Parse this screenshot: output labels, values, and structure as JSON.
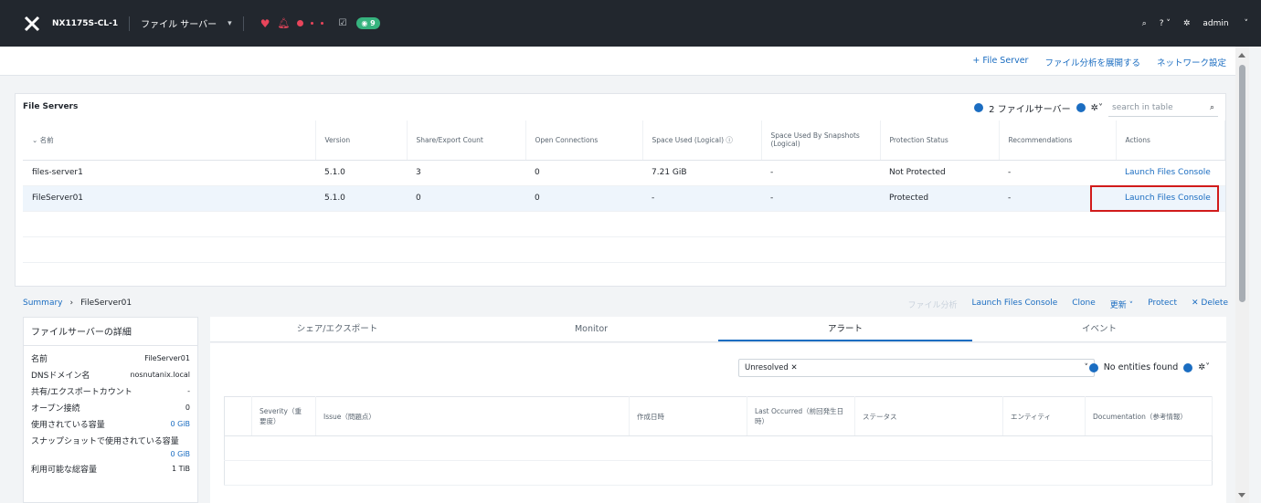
{
  "topnav": {
    "cluster": "NX1175S-CL-1",
    "menu": "ファイル サーバー",
    "task_count": "9",
    "user": "admin"
  },
  "actionbar": {
    "add_file_server": "+ File Server",
    "deploy_analytics": "ファイル分析を展開する",
    "network_settings": "ネットワーク設定"
  },
  "file_servers": {
    "title": "File Servers",
    "count_label": "2 ファイルサーバー",
    "search_placeholder": "search in table",
    "columns": [
      "名前",
      "Version",
      "Share/Export Count",
      "Open Connections",
      "Space Used (Logical)",
      "Space Used By Snapshots (Logical)",
      "Protection Status",
      "Recommendations",
      "Actions"
    ],
    "rows": [
      {
        "name": "files-server1",
        "version": "5.1.0",
        "shares": "3",
        "connections": "0",
        "space": "7.21 GiB",
        "snap": "-",
        "protection": "Not Protected",
        "rec": "-",
        "action": "Launch Files Console"
      },
      {
        "name": "FileServer01",
        "version": "5.1.0",
        "shares": "0",
        "connections": "0",
        "space": "-",
        "snap": "-",
        "protection": "Protected",
        "rec": "-",
        "action": "Launch Files Console"
      }
    ]
  },
  "summary": {
    "crumb_root": "Summary",
    "crumb_current": "FileServer01",
    "actions": {
      "analytics": "ファイル分析",
      "launch": "Launch Files Console",
      "clone": "Clone",
      "update": "更新",
      "protect": "Protect",
      "delete": "Delete"
    }
  },
  "details": {
    "title": "ファイルサーバーの詳細",
    "rows": [
      {
        "label": "名前",
        "value": "FileServer01"
      },
      {
        "label": "DNSドメイン名",
        "value": "nosnutanix.local"
      },
      {
        "label": "共有/エクスポートカウント",
        "value": "-"
      },
      {
        "label": "オープン接続",
        "value": "0"
      },
      {
        "label": "使用されている容量",
        "value": "0 GiB"
      }
    ],
    "snap_label": "スナップショットで使用されている容量",
    "snap_value": "0 GiB",
    "total_label": "利用可能な総容量",
    "total_value": "1 TiB"
  },
  "tabs": [
    "シェア/エクスポート",
    "Monitor",
    "アラート",
    "イベント"
  ],
  "alerts": {
    "filter_chip": "Unresolved",
    "no_entities": "No entities found",
    "columns": [
      "Severity（重要度）",
      "Issue（問題点）",
      "作成日時",
      "Last Occurred（前回発生日時）",
      "ステータス",
      "エンティティ",
      "Documentation（参考情報）"
    ]
  }
}
